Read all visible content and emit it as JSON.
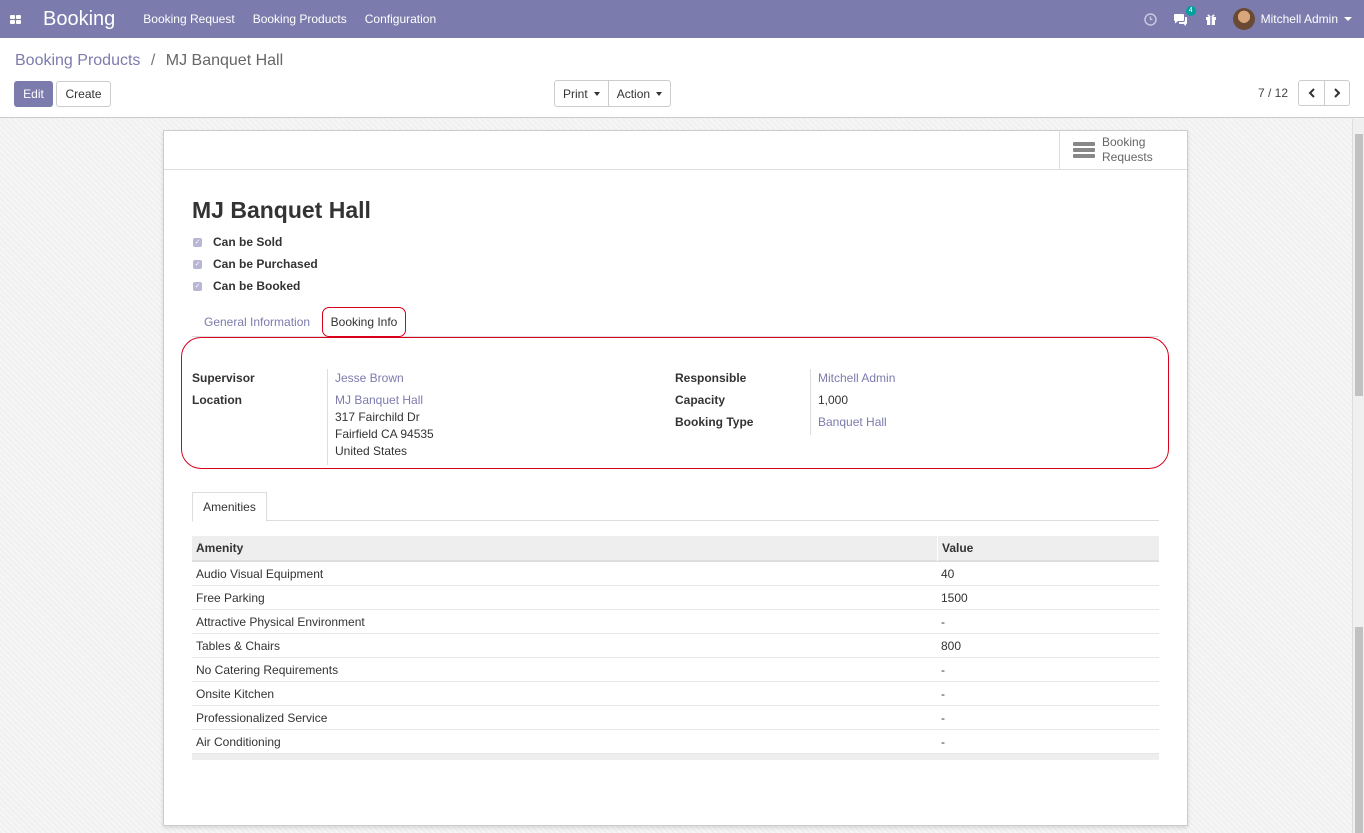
{
  "navbar": {
    "brand": "Booking",
    "menu": [
      "Booking Request",
      "Booking Products",
      "Configuration"
    ],
    "messages_count": "4",
    "user_name": "Mitchell Admin",
    "colors": {
      "bar": "#7c7bad",
      "badge": "#00a09d"
    }
  },
  "control_panel": {
    "breadcrumb_parent": "Booking Products",
    "breadcrumb_separator": "/",
    "breadcrumb_current": "MJ Banquet Hall",
    "edit_label": "Edit",
    "create_label": "Create",
    "print_label": "Print",
    "action_label": "Action",
    "pager_value": "7 / 12"
  },
  "sheet": {
    "smart_button": {
      "line1": "Booking",
      "line2": "Requests"
    },
    "title": "MJ Banquet Hall",
    "checkboxes": [
      {
        "label": "Can be Sold",
        "checked": true
      },
      {
        "label": "Can be Purchased",
        "checked": true
      },
      {
        "label": "Can be Booked",
        "checked": true
      }
    ],
    "tabs": [
      "General Information",
      "Booking Info"
    ],
    "active_tab": "Booking Info",
    "fields": {
      "supervisor_label": "Supervisor",
      "supervisor_value": "Jesse Brown",
      "location_label": "Location",
      "location_name": "MJ Banquet Hall",
      "location_street": "317 Fairchild Dr",
      "location_city": "Fairfield CA 94535",
      "location_country": "United States",
      "responsible_label": "Responsible",
      "responsible_value": "Mitchell Admin",
      "capacity_label": "Capacity",
      "capacity_value": "1,000",
      "booking_type_label": "Booking Type",
      "booking_type_value": "Banquet Hall"
    },
    "sub_tab": "Amenities",
    "table": {
      "headers": [
        "Amenity",
        "Value"
      ],
      "rows": [
        {
          "amenity": "Audio Visual Equipment",
          "value": "40"
        },
        {
          "amenity": "Free Parking",
          "value": "1500"
        },
        {
          "amenity": "Attractive Physical Environment",
          "value": "-"
        },
        {
          "amenity": "Tables & Chairs",
          "value": "800"
        },
        {
          "amenity": "No Catering Requirements",
          "value": "-"
        },
        {
          "amenity": "Onsite Kitchen",
          "value": "-"
        },
        {
          "amenity": "Professionalized Service",
          "value": "-"
        },
        {
          "amenity": "Air Conditioning",
          "value": "-"
        }
      ]
    },
    "highlight_color": "#d9001b"
  }
}
